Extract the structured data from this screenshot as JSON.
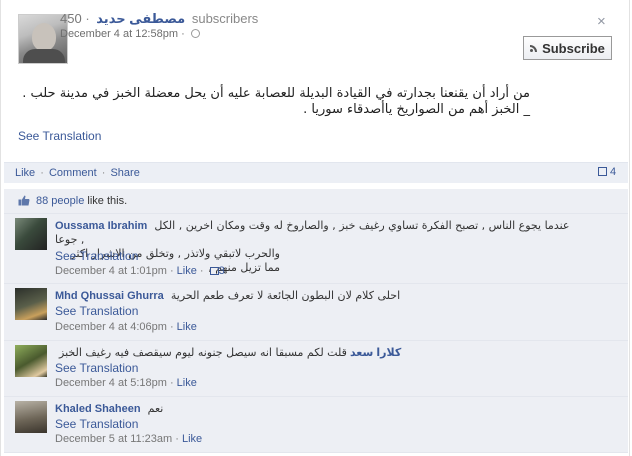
{
  "post": {
    "subscriber_count": "450",
    "author": "مصطفى حديد",
    "subscribers_label": "subscribers",
    "timestamp": "December 4 at 12:58pm",
    "separator": "·",
    "subscribe_label": "Subscribe",
    "close_glyph": "×",
    "text_line1": "من أراد أن يقنعنا بجدارته في القيادة البديلة للعصابة عليه أن يحل معضلة الخبز في مدينة حلب .",
    "text_line2": "_ الخبز أهم من الصواريخ ياأصدقاء سوريا .",
    "see_translation": "See Translation"
  },
  "actions": {
    "like": "Like",
    "comment": "Comment",
    "share": "Share",
    "separator": "·",
    "comment_count": "4"
  },
  "likes": {
    "count_text": "88 people",
    "suffix": "like this."
  },
  "comments": [
    {
      "name": "Oussama Ibrahim",
      "text_line1": "عندما يجوع الناس , تصبح الفكرة تساوي رغيف خبز , والصاروخ له وقت ومكان اخرين , الكل جوعا ,",
      "text_line2": "والحرب لاتبقي ولاتذر , وتخلق من الاشرار اكثر مما تزيل منهم ,",
      "see_translation": "See Translation",
      "timestamp": "December 4 at 1:01pm",
      "like_label": "Like",
      "like_count": "3",
      "avatar_color": "#3a4a3c"
    },
    {
      "name": "Mhd Qhussai Ghurra",
      "text_line1": "احلى كلام لان البطون الجائعة لا تعرف طعم الحرية",
      "see_translation": "See Translation",
      "timestamp": "December 4 at 4:06pm",
      "like_label": "Like",
      "avatar_color": "#5a5f4a"
    },
    {
      "name": "كلارا سعد",
      "text_line1": "قلت لكم مسبقا انه سيصل جنونه ليوم سيقصف فيه رغيف الخبز",
      "see_translation": "See Translation",
      "timestamp": "December 4 at 5:18pm",
      "like_label": "Like",
      "avatar_color": "#4a5a2e"
    },
    {
      "name": "Khaled Shaheen",
      "text_line1": "نعم",
      "see_translation": "See Translation",
      "timestamp": "December 5 at 11:23am",
      "like_label": "Like",
      "avatar_color": "#6e6658"
    }
  ],
  "colors": {
    "link": "#3b5998",
    "comment_bg": "#edeff4",
    "action_bar_bg": "#eceff5"
  }
}
